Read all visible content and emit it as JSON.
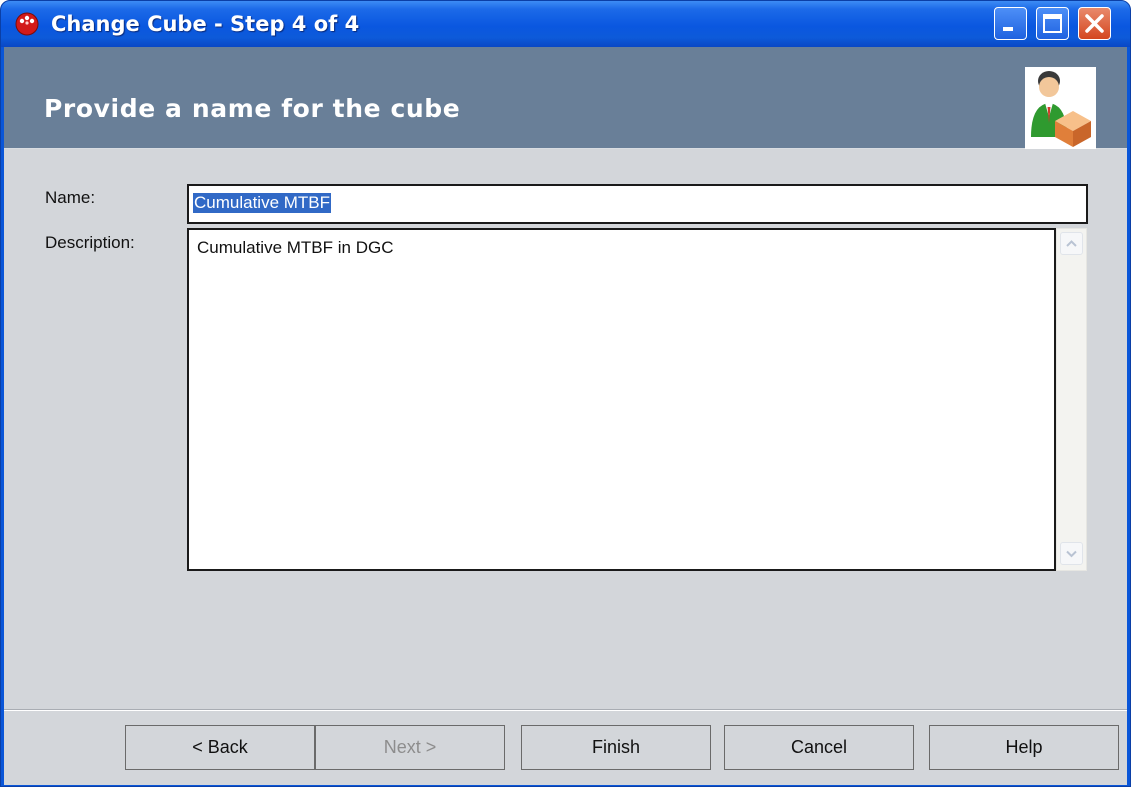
{
  "window": {
    "title": "Change Cube - Step 4 of 4"
  },
  "header": {
    "title": "Provide a name for the cube"
  },
  "form": {
    "name_label": "Name:",
    "name_value": "Cumulative MTBF",
    "description_label": "Description:",
    "description_value": "Cumulative MTBF in DGC"
  },
  "buttons": {
    "back": "< Back",
    "next": "Next >",
    "finish": "Finish",
    "cancel": "Cancel",
    "help": "Help"
  },
  "colors": {
    "titlebar": "#0a57e0",
    "header_band": "#697f98",
    "client_bg": "#d3d6da",
    "selection": "#3169c6"
  }
}
